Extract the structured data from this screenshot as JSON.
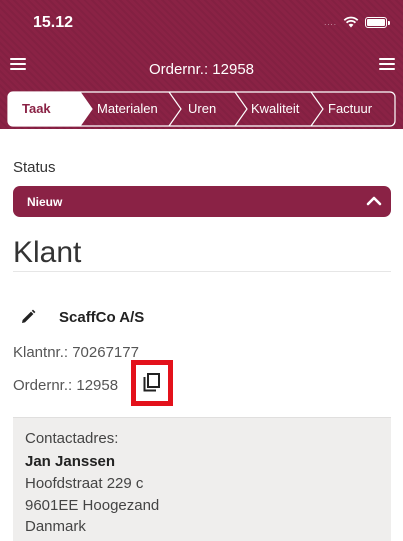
{
  "statusbar": {
    "time": "15.12",
    "signal": "....",
    "icons": [
      "wifi-icon",
      "battery-icon"
    ]
  },
  "appbar": {
    "title": "Ordernr.: 12958",
    "left_icon": "menu-icon",
    "right_icon": "menu-icon"
  },
  "tabs": [
    {
      "label": "Taak",
      "active": true
    },
    {
      "label": "Materialen",
      "active": false
    },
    {
      "label": "Uren",
      "active": false
    },
    {
      "label": "Kwaliteit",
      "active": false
    },
    {
      "label": "Factuur",
      "active": false
    }
  ],
  "status": {
    "label": "Status",
    "value": "Nieuw"
  },
  "klant": {
    "title": "Klant",
    "company": "ScaffCo A/S",
    "klantnr_label": "Klantnr.:",
    "klantnr": "70267177",
    "ordernr_label": "Ordernr.:",
    "ordernr": "12958"
  },
  "contact": {
    "label": "Contactadres:",
    "name": "Jan Janssen",
    "street": "Hoofdstraat 229 c",
    "city": "9601EE Hoogezand",
    "country": "Danmark"
  },
  "colors": {
    "brand": "#8a2245",
    "highlight": "#e3111b",
    "contact_bg": "#efeeed"
  }
}
